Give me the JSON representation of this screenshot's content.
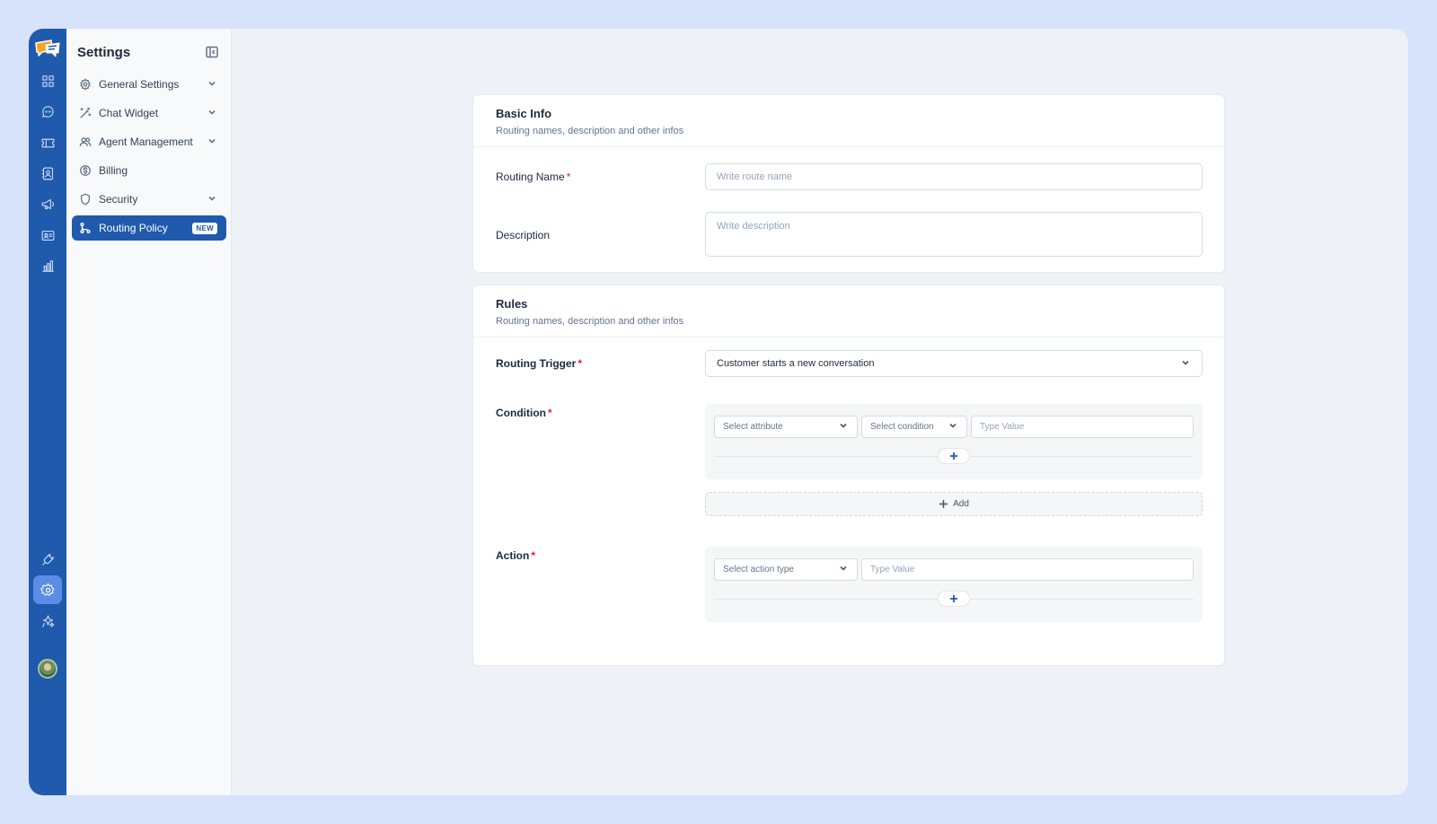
{
  "sidebar": {
    "title": "Settings",
    "items": [
      {
        "label": "General Settings",
        "icon": "gear-icon"
      },
      {
        "label": "Chat Widget",
        "icon": "magic-wand-icon"
      },
      {
        "label": "Agent Management",
        "icon": "users-icon"
      },
      {
        "label": "Billing",
        "icon": "dollar-icon"
      },
      {
        "label": "Security",
        "icon": "shield-icon"
      },
      {
        "label": "Routing Policy",
        "icon": "route-icon",
        "badge": "NEW"
      }
    ]
  },
  "rail": {
    "icons": [
      "dashboard-icon",
      "chat-icon",
      "ticket-icon",
      "contacts-icon",
      "megaphone-icon",
      "inbox-icon",
      "analytics-icon",
      "plug-icon",
      "settings-icon",
      "sparkle-icon",
      "avatar"
    ],
    "active": "settings-icon"
  },
  "basic_info": {
    "title": "Basic Info",
    "subtitle": "Routing names, description and other infos",
    "routing_name_label": "Routing Name",
    "routing_name_placeholder": "Write route name",
    "description_label": "Description",
    "description_placeholder": "Write description"
  },
  "rules": {
    "title": "Rules",
    "subtitle": "Routing names, description and other infos",
    "trigger_label": "Routing Trigger",
    "trigger_value": "Customer starts a new conversation",
    "condition_label": "Condition",
    "condition": {
      "attribute_placeholder": "Select attribute",
      "condition_placeholder": "Select condition",
      "value_placeholder": "Type Value"
    },
    "add_label": "Add",
    "action_label": "Action",
    "action": {
      "type_placeholder": "Select action type",
      "value_placeholder": "Type Value"
    }
  },
  "colors": {
    "accent": "#1f5aad",
    "required": "#e11d48",
    "background": "#d6e3fb"
  }
}
